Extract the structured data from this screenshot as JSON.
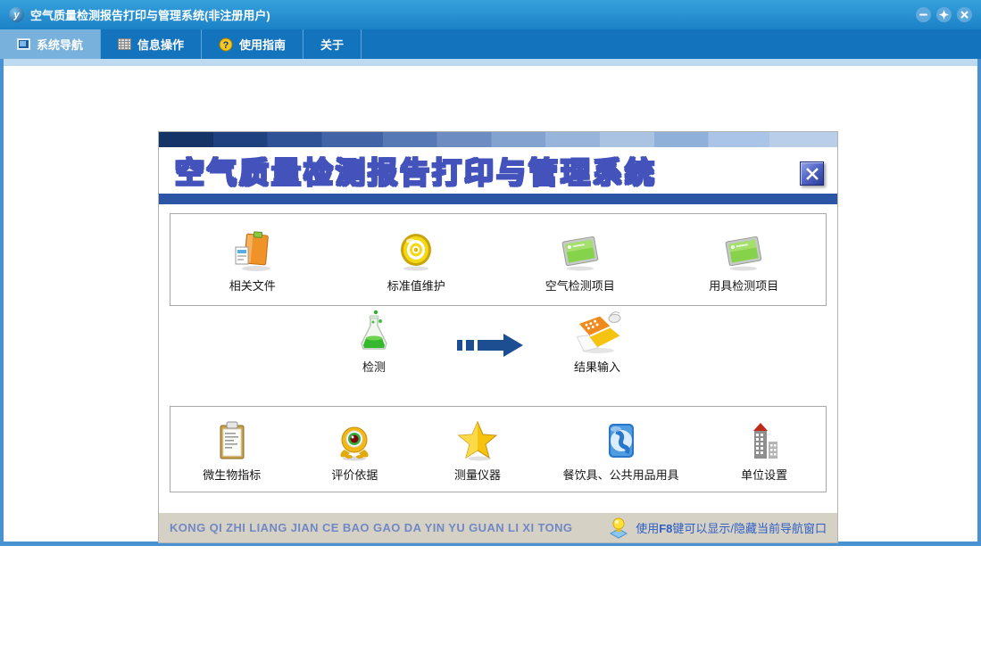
{
  "titlebar": {
    "title": "空气质量检测报告打印与管理系统(非注册用户)",
    "app_logo_letter": "y"
  },
  "tabs": [
    {
      "label": "系统导航",
      "active": true
    },
    {
      "label": "信息操作"
    },
    {
      "label": "使用指南"
    },
    {
      "label": "关于"
    }
  ],
  "panel": {
    "title": "空气质量检测报告打印与管理系统",
    "row1": [
      {
        "label": "相关文件",
        "icon": "folder-icon"
      },
      {
        "label": "标准值维护",
        "icon": "target-icon"
      },
      {
        "label": "空气检测项目",
        "icon": "green-screen-icon"
      },
      {
        "label": "用具检测项目",
        "icon": "green-screen-icon"
      }
    ],
    "row2": [
      {
        "label": "检测",
        "icon": "flask-icon"
      },
      {
        "label": "结果输入",
        "icon": "notebook-mouse-icon"
      }
    ],
    "row3": [
      {
        "label": "微生物指标",
        "icon": "clipboard-icon"
      },
      {
        "label": "评价依据",
        "icon": "eye-creature-icon"
      },
      {
        "label": "测量仪器",
        "icon": "star-icon"
      },
      {
        "label": "餐饮具、公共用品用具",
        "icon": "globe-icon"
      },
      {
        "label": "单位设置",
        "icon": "building-icon"
      }
    ],
    "status": {
      "pinyin": "KONG QI ZHI LIANG JIAN CE BAO GAO DA YIN YU GUAN LI XI TONG",
      "hint_prefix": "使用",
      "hint_key": "F8",
      "hint_suffix": "键可以显示/隐藏当前导航窗口"
    }
  },
  "colors": {
    "titlebar_blue": "#1b82c6",
    "tabbar_blue": "#1473bd",
    "active_tab_blue": "#79b1dd",
    "window_border_blue": "#4992d2",
    "panel_bar_blue": "#2d55a5",
    "status_bar_gray": "#d5d1c5",
    "pinyin_text": "#7288c6",
    "hint_text": "#2e5ec6",
    "arrow_navy": "#1d4e91"
  }
}
